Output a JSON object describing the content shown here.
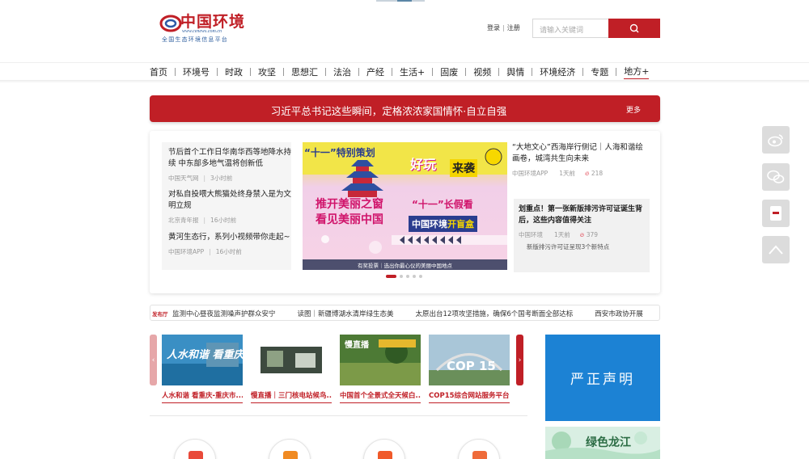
{
  "header": {
    "logo_name": "中国环境",
    "logo_url": "www.cenews.com.cn",
    "logo_slogan": "全国生态环境信息平台",
    "login": "登录",
    "register": "注册",
    "search_placeholder": "请输入关键词",
    "search_icon": "search-icon"
  },
  "nav": {
    "items": [
      "首页",
      "环境号",
      "时政",
      "攻坚",
      "思想汇",
      "法治",
      "产经",
      "生活+",
      "固废",
      "视频",
      "舆情",
      "环境经济",
      "专题",
      "地方+"
    ],
    "active_index": 13
  },
  "banner": {
    "text": "习近平总书记这些瞬间，定格浓浓家国情怀·自立自强",
    "more": "更多"
  },
  "featured": {
    "left_news": [
      {
        "title": "节后首个工作日华南华西等地降水持续 中东部多地气温将创新低",
        "source": "中国天气网",
        "time": "3小时前"
      },
      {
        "title": "对私自投喂大熊猫处终身禁入是为文明立规",
        "source": "北京青年报",
        "time": "16小时前"
      },
      {
        "title": "黄河生态行，系列小视频带你走起~",
        "source": "中国环境APP",
        "time": "16小时前"
      }
    ],
    "poster": {
      "tag": "“十一”特别策划",
      "haowan": "好玩",
      "laixi": "来袭",
      "left_line1": "推开美丽之窗",
      "left_line2": "看见美丽中国",
      "right_line1": "“十一”长假看",
      "right_line2_a": "中国环境",
      "right_line2_b": "开盲盒",
      "caption": "有奖投票｜选出你最心仪的美丽中国地点"
    },
    "right_top": {
      "title": "“大地文心”西海岸行侧记｜人海和谐绘画卷，城湾共生向未来",
      "source": "中国环境APP",
      "time": "1天前",
      "views": "218"
    },
    "right_box": {
      "title": "划重点！第一张新版排污许可证诞生背后，这些内容值得关注",
      "source": "中国环境",
      "time": "1天前",
      "views": "379",
      "sub": "新版排污许可证呈现3个新特点"
    },
    "slides_total": 5,
    "slide_active": 0
  },
  "ticker": {
    "badge": "发布厅",
    "items": [
      "监测中心昼夜监测噪声护群众安宁",
      "读图｜新疆博湖水清岸绿生态美",
      "太原出台12项攻坚措施，确保6个国考断面全部达标",
      "西安市政协开展"
    ]
  },
  "carousel": {
    "cards": [
      {
        "label": "人水和谐 看重庆-重庆市..."
      },
      {
        "label": "慢直播｜三门核电站候鸟..."
      },
      {
        "label": "中国首个全景式全天候白..."
      },
      {
        "label": "COP15综合网站服务平台"
      }
    ],
    "card1_art": "人水和谐 看重庆",
    "card3_art": "慢直播",
    "card4_art": "COP 15"
  },
  "right_col": {
    "yanzheng": "严正声明",
    "longjiang": "绿色龙江"
  },
  "side_icons": [
    "weibo-icon",
    "wechat-icon",
    "app-icon",
    "back-to-top-icon"
  ],
  "colors": {
    "brand_red": "#c01f26",
    "blue": "#1c82d4"
  }
}
